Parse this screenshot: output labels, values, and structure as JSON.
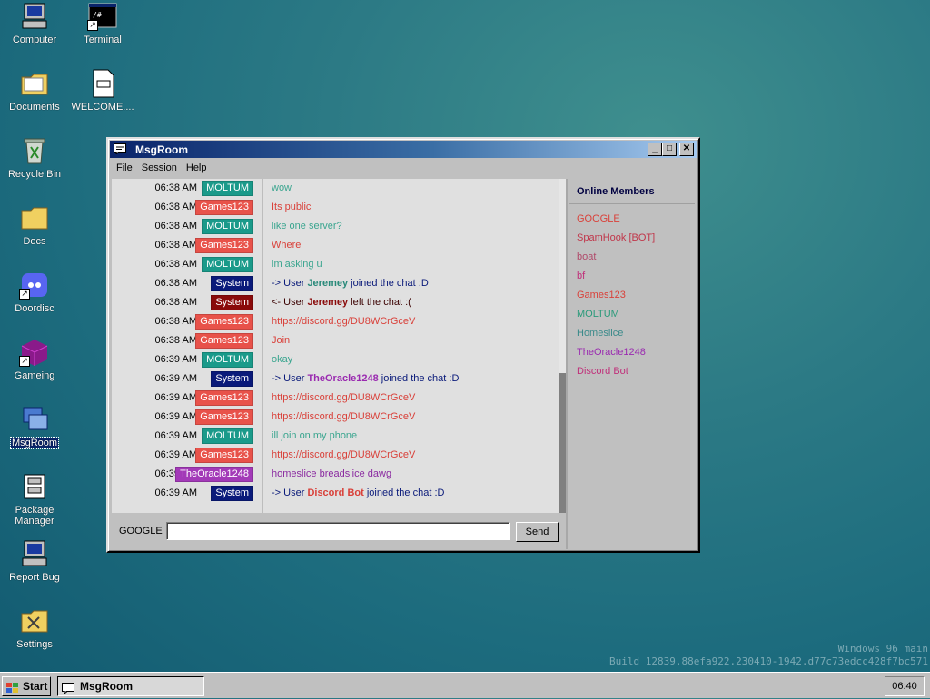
{
  "desktop": {
    "icons": [
      {
        "label": "Computer"
      },
      {
        "label": "Terminal"
      },
      {
        "label": "Documents"
      },
      {
        "label": "WELCOME...."
      },
      {
        "label": "Recycle Bin"
      },
      {
        "label": "Docs"
      },
      {
        "label": "Doordisc"
      },
      {
        "label": "Gameing"
      },
      {
        "label": "MsgRoom"
      },
      {
        "label": "Package Manager"
      },
      {
        "label": "Report Bug"
      },
      {
        "label": "Settings"
      }
    ],
    "watermark_line1": "Windows 96 main",
    "watermark_line2": "Build 12839.88efa922.230410-1942.d77c73edcc428f7bc571"
  },
  "window": {
    "title": "MsgRoom",
    "menu": [
      "File",
      "Session",
      "Help"
    ],
    "messages": [
      {
        "time": "06:38 AM",
        "user": "MOLTUM",
        "text": "wow",
        "badge_color": "#1a9a8a",
        "text_color": "#3aa58f"
      },
      {
        "time": "06:38 AM",
        "user": "Games123",
        "text": "Its public",
        "badge_color": "#e8524a",
        "text_color": "#d9413a"
      },
      {
        "time": "06:38 AM",
        "user": "MOLTUM",
        "text": "like one server?",
        "badge_color": "#1a9a8a",
        "text_color": "#3aa58f"
      },
      {
        "time": "06:38 AM",
        "user": "Games123",
        "text": "Where",
        "badge_color": "#e8524a",
        "text_color": "#d9413a"
      },
      {
        "time": "06:38 AM",
        "user": "MOLTUM",
        "text": "im asking u",
        "badge_color": "#1a9a8a",
        "text_color": "#3aa58f"
      },
      {
        "time": "06:38 AM",
        "user": "System",
        "pre": "-> User ",
        "name": "Jeremey",
        "post": " joined the chat :D",
        "badge_color": "#0a1a7a",
        "name_color": "#2a8a7a",
        "text_color": "#0a1a7a"
      },
      {
        "time": "06:38 AM",
        "user": "System",
        "pre": "<- User ",
        "name": "Jeremey",
        "post": " left the chat :(",
        "badge_color": "#8a0a0a",
        "name_color": "#8a0a0a",
        "text_color": "#3a0000"
      },
      {
        "time": "06:38 AM",
        "user": "Games123",
        "text": "https://discord.gg/DU8WCrGceV",
        "badge_color": "#e8524a",
        "text_color": "#d9413a"
      },
      {
        "time": "06:38 AM",
        "user": "Games123",
        "text": "Join",
        "badge_color": "#e8524a",
        "text_color": "#d9413a"
      },
      {
        "time": "06:39 AM",
        "user": "MOLTUM",
        "text": "okay",
        "badge_color": "#1a9a8a",
        "text_color": "#3aa58f"
      },
      {
        "time": "06:39 AM",
        "user": "System",
        "pre": "-> User ",
        "name": "TheOracle1248",
        "post": " joined the chat :D",
        "badge_color": "#0a1a7a",
        "name_color": "#9a2ab0",
        "text_color": "#0a1a7a"
      },
      {
        "time": "06:39 AM",
        "user": "Games123",
        "text": "https://discord.gg/DU8WCrGceV",
        "badge_color": "#e8524a",
        "text_color": "#d9413a"
      },
      {
        "time": "06:39 AM",
        "user": "Games123",
        "text": "https://discord.gg/DU8WCrGceV",
        "badge_color": "#e8524a",
        "text_color": "#d9413a"
      },
      {
        "time": "06:39 AM",
        "user": "MOLTUM",
        "text": "ill join on my phone",
        "badge_color": "#1a9a8a",
        "text_color": "#3aa58f"
      },
      {
        "time": "06:39 AM",
        "user": "Games123",
        "text": "https://discord.gg/DU8WCrGceV",
        "badge_color": "#e8524a",
        "text_color": "#d9413a"
      },
      {
        "time": "06:39 AM",
        "user": "TheOracle1248",
        "text": "homeslice breadslice dawg",
        "badge_color": "#a33ab8",
        "text_color": "#8a2aa0"
      },
      {
        "time": "06:39 AM",
        "user": "System",
        "pre": "-> User ",
        "name": "Discord Bot",
        "post": " joined the chat :D",
        "badge_color": "#0a1a7a",
        "name_color": "#d9413a",
        "text_color": "#0a1a7a"
      }
    ],
    "input": {
      "username": "GOOGLE",
      "value": "",
      "send_label": "Send"
    },
    "members_title": "Online Members",
    "members": [
      {
        "name": "GOOGLE",
        "color": "#d9413a"
      },
      {
        "name": "SpamHook [BOT]",
        "color": "#c0364a"
      },
      {
        "name": "boat",
        "color": "#b04a6a"
      },
      {
        "name": "bf",
        "color": "#c0307a"
      },
      {
        "name": "Games123",
        "color": "#d9413a"
      },
      {
        "name": "MOLTUM",
        "color": "#2a9a7a"
      },
      {
        "name": "Homeslice",
        "color": "#3a8a8a"
      },
      {
        "name": "TheOracle1248",
        "color": "#9a2ab0"
      },
      {
        "name": "Discord Bot",
        "color": "#c0307a"
      }
    ]
  },
  "taskbar": {
    "start_label": "Start",
    "task_label": "MsgRoom",
    "clock": "06:40"
  }
}
